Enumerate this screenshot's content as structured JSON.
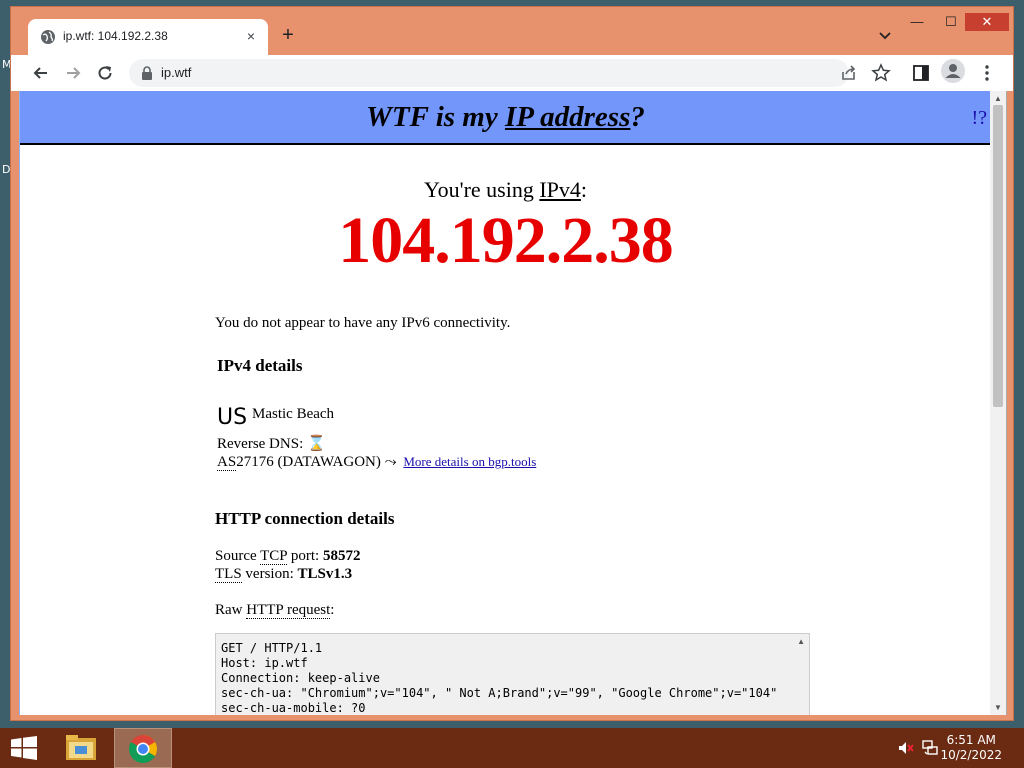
{
  "desktop": {
    "icon_label_1": "M",
    "icon_label_2": "D"
  },
  "browser": {
    "tab_title": "ip.wtf: 104.192.2.38",
    "tab_close": "×",
    "new_tab": "+",
    "url": "ip.wtf",
    "window_controls": {
      "minimize": "—",
      "maximize": "☐",
      "close": "✕"
    }
  },
  "page": {
    "banner": {
      "prefix": "WTF is my ",
      "link": "IP address",
      "suffix": "?",
      "help": "!?"
    },
    "using": {
      "prefix": "You're using ",
      "protocol": "IPv4",
      "suffix": ":"
    },
    "ip": "104.192.2.38",
    "no_ipv6": "You do not appear to have any IPv6 connectivity.",
    "ipv4_details_heading": "IPv4 details",
    "country_code": "US",
    "city": "Mastic Beach",
    "reverse_dns_label": "Reverse DNS:",
    "reverse_dns_value": "⌛",
    "as_abbr": "AS",
    "as_number": "27176 (DATAWAGON)",
    "as_arrow": " ⤳ ",
    "bgp_link": "More details on bgp.tools",
    "http_heading": "HTTP connection details",
    "source_prefix": "Source ",
    "tcp_abbr": "TCP",
    "source_suffix": " port: ",
    "source_port": "58572",
    "tls_abbr": "TLS",
    "tls_suffix": " version: ",
    "tls_version": "TLSv1.3",
    "raw_prefix": "Raw ",
    "http_abbr": "HTTP",
    "raw_request_word": " request",
    "raw_colon": ":",
    "raw_request": "GET / HTTP/1.1\nHost: ip.wtf\nConnection: keep-alive\nsec-ch-ua: \"Chromium\";v=\"104\", \" Not A;Brand\";v=\"99\", \"Google Chrome\";v=\"104\"\nsec-ch-ua-mobile: ?0"
  },
  "taskbar": {
    "time": "6:51 AM",
    "date": "10/2/2022"
  },
  "colors": {
    "banner": "#7396fb",
    "ip": "#e60000",
    "window_frame": "#e8926d",
    "taskbar": "#6b2a12"
  }
}
